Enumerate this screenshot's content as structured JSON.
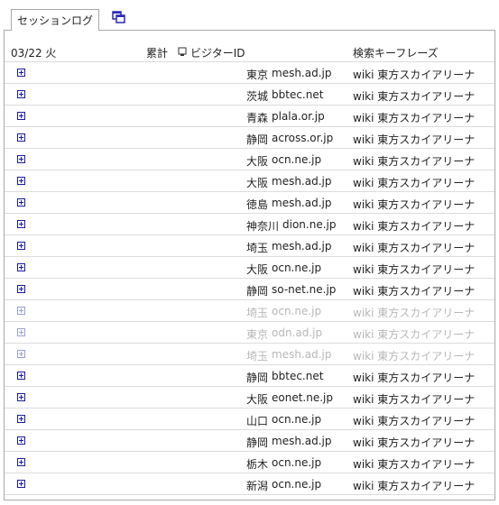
{
  "tabs": {
    "session_log": "セッションログ"
  },
  "table": {
    "headers": {
      "date": "03/22 火",
      "total": "累計",
      "visitor_id": "ビジターID",
      "search_phrase": "検索キーフレーズ"
    },
    "rows": [
      {
        "pref": "東京",
        "host": "mesh.ad.jp",
        "keyword": "wiki 東方スカイアリーナ",
        "faded": false
      },
      {
        "pref": "茨城",
        "host": "bbtec.net",
        "keyword": "wiki 東方スカイアリーナ",
        "faded": false
      },
      {
        "pref": "青森",
        "host": "plala.or.jp",
        "keyword": "wiki 東方スカイアリーナ",
        "faded": false
      },
      {
        "pref": "静岡",
        "host": "across.or.jp",
        "keyword": "wiki 東方スカイアリーナ",
        "faded": false
      },
      {
        "pref": "大阪",
        "host": "ocn.ne.jp",
        "keyword": "wiki 東方スカイアリーナ",
        "faded": false
      },
      {
        "pref": "大阪",
        "host": "mesh.ad.jp",
        "keyword": "wiki 東方スカイアリーナ",
        "faded": false
      },
      {
        "pref": "徳島",
        "host": "mesh.ad.jp",
        "keyword": "wiki 東方スカイアリーナ",
        "faded": false
      },
      {
        "pref": "神奈川",
        "host": "dion.ne.jp",
        "keyword": "wiki 東方スカイアリーナ",
        "faded": false
      },
      {
        "pref": "埼玉",
        "host": "mesh.ad.jp",
        "keyword": "wiki 東方スカイアリーナ",
        "faded": false
      },
      {
        "pref": "大阪",
        "host": "ocn.ne.jp",
        "keyword": "wiki 東方スカイアリーナ",
        "faded": false
      },
      {
        "pref": "静岡",
        "host": "so-net.ne.jp",
        "keyword": "wiki 東方スカイアリーナ",
        "faded": false
      },
      {
        "pref": "埼玉",
        "host": "ocn.ne.jp",
        "keyword": "wiki 東方スカイアリーナ",
        "faded": true
      },
      {
        "pref": "東京",
        "host": "odn.ad.jp",
        "keyword": "wiki 東方スカイアリーナ",
        "faded": true
      },
      {
        "pref": "埼玉",
        "host": "mesh.ad.jp",
        "keyword": "wiki 東方スカイアリーナ",
        "faded": true
      },
      {
        "pref": "静岡",
        "host": "bbtec.net",
        "keyword": "wiki 東方スカイアリーナ",
        "faded": false
      },
      {
        "pref": "大阪",
        "host": "eonet.ne.jp",
        "keyword": "wiki 東方スカイアリーナ",
        "faded": false
      },
      {
        "pref": "山口",
        "host": "ocn.ne.jp",
        "keyword": "wiki 東方スカイアリーナ",
        "faded": false
      },
      {
        "pref": "静岡",
        "host": "mesh.ad.jp",
        "keyword": "wiki 東方スカイアリーナ",
        "faded": false
      },
      {
        "pref": "栃木",
        "host": "ocn.ne.jp",
        "keyword": "wiki 東方スカイアリーナ",
        "faded": false
      },
      {
        "pref": "新潟",
        "host": "ocn.ne.jp",
        "keyword": "wiki 東方スカイアリーナ",
        "faded": false
      }
    ]
  },
  "icons": {
    "tab_icon": "copy-window-icon",
    "expand": "plus-box-icon",
    "visitor": "visitor-icon"
  },
  "colors": {
    "expand_icon": "#1a1aa8",
    "tab_icon": "#2a2ab8",
    "border": "#a9a9a9",
    "row_divider": "#dcdcdc",
    "faded_text": "#b8b8b8"
  }
}
